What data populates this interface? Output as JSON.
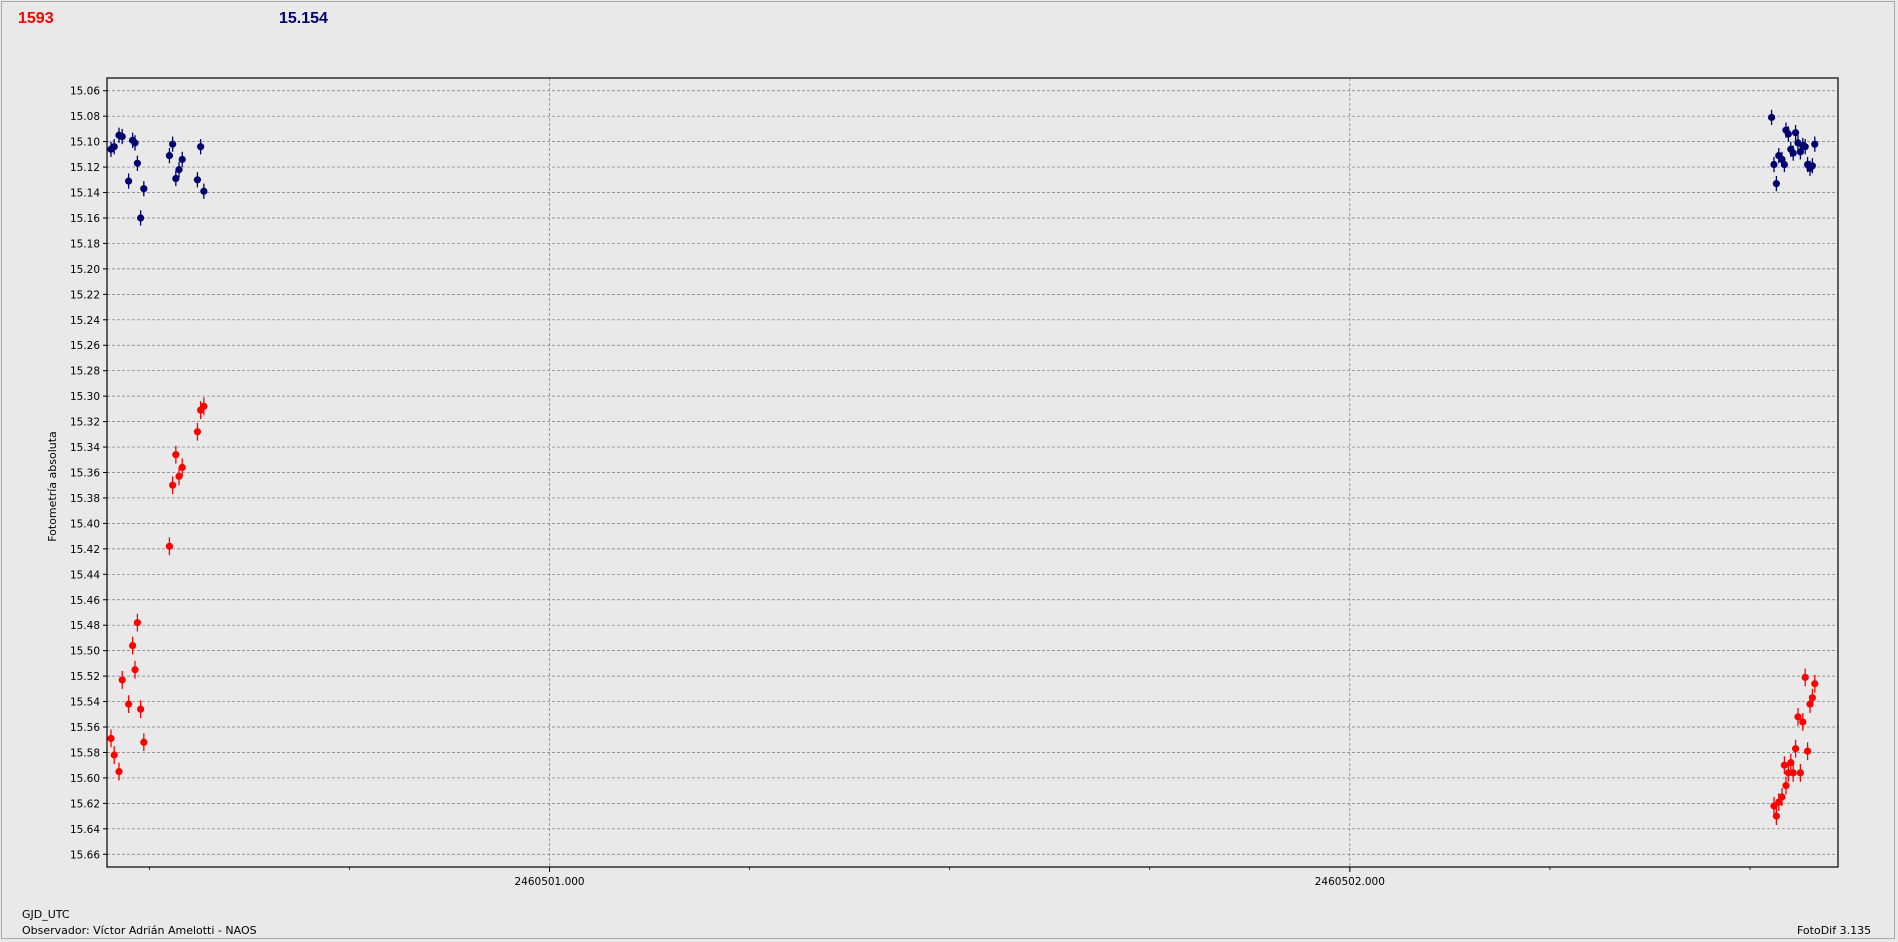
{
  "header": {
    "count": "1593",
    "magnitude": "15.154"
  },
  "footer": {
    "x_axis_name": "GJD_UTC",
    "observer": "Observador: Víctor Adrián Amelotti - NAOS",
    "software": "FotoDif 3.135"
  },
  "colors": {
    "series_red": "#ff0000",
    "series_blue": "#00006e",
    "background": "#e9e9e9"
  },
  "chart_data": {
    "type": "scatter",
    "title": "",
    "xlabel": "GJD_UTC",
    "ylabel": "Fotometría absoluta",
    "y_inverted": true,
    "ylim": [
      15.05,
      15.67
    ],
    "xlim": [
      2460500.447,
      2460502.61
    ],
    "x_ticks": [
      {
        "value": 2460501.0,
        "label": "2460501.000"
      },
      {
        "value": 2460502.0,
        "label": "2460502.000"
      }
    ],
    "y_ticks": [
      "15.06",
      "15.08",
      "15.10",
      "15.12",
      "15.14",
      "15.16",
      "15.18",
      "15.20",
      "15.22",
      "15.24",
      "15.26",
      "15.28",
      "15.30",
      "15.32",
      "15.34",
      "15.36",
      "15.38",
      "15.40",
      "15.42",
      "15.44",
      "15.46",
      "15.48",
      "15.50",
      "15.52",
      "15.54",
      "15.56",
      "15.58",
      "15.60",
      "15.62",
      "15.64",
      "15.66"
    ],
    "grid": true,
    "series": [
      {
        "color": "#ff0000",
        "error": 0.007,
        "points": [
          [
            2460500.452,
            15.569
          ],
          [
            2460500.456,
            15.582
          ],
          [
            2460500.462,
            15.595
          ],
          [
            2460500.466,
            15.523
          ],
          [
            2460500.474,
            15.542
          ],
          [
            2460500.479,
            15.496
          ],
          [
            2460500.482,
            15.515
          ],
          [
            2460500.485,
            15.478
          ],
          [
            2460500.489,
            15.546
          ],
          [
            2460500.493,
            15.572
          ],
          [
            2460500.525,
            15.418
          ],
          [
            2460500.529,
            15.37
          ],
          [
            2460500.533,
            15.346
          ],
          [
            2460500.537,
            15.363
          ],
          [
            2460500.541,
            15.356
          ],
          [
            2460500.56,
            15.328
          ],
          [
            2460500.564,
            15.311
          ],
          [
            2460500.568,
            15.308
          ],
          [
            2460502.53,
            15.622
          ],
          [
            2460502.533,
            15.63
          ],
          [
            2460502.536,
            15.619
          ],
          [
            2460502.54,
            15.615
          ],
          [
            2460502.543,
            15.59
          ],
          [
            2460502.545,
            15.606
          ],
          [
            2460502.548,
            15.596
          ],
          [
            2460502.551,
            15.588
          ],
          [
            2460502.554,
            15.596
          ],
          [
            2460502.557,
            15.577
          ],
          [
            2460502.56,
            15.552
          ],
          [
            2460502.563,
            15.596
          ],
          [
            2460502.566,
            15.556
          ],
          [
            2460502.569,
            15.521
          ],
          [
            2460502.572,
            15.579
          ],
          [
            2460502.575,
            15.542
          ],
          [
            2460502.578,
            15.537
          ],
          [
            2460502.581,
            15.526
          ]
        ]
      },
      {
        "color": "#00006e",
        "error": 0.006,
        "points": [
          [
            2460500.452,
            15.106
          ],
          [
            2460500.456,
            15.104
          ],
          [
            2460500.462,
            15.095
          ],
          [
            2460500.466,
            15.096
          ],
          [
            2460500.474,
            15.131
          ],
          [
            2460500.479,
            15.099
          ],
          [
            2460500.482,
            15.101
          ],
          [
            2460500.485,
            15.117
          ],
          [
            2460500.489,
            15.16
          ],
          [
            2460500.493,
            15.137
          ],
          [
            2460500.525,
            15.111
          ],
          [
            2460500.529,
            15.102
          ],
          [
            2460500.533,
            15.129
          ],
          [
            2460500.537,
            15.122
          ],
          [
            2460500.541,
            15.114
          ],
          [
            2460500.56,
            15.13
          ],
          [
            2460500.564,
            15.104
          ],
          [
            2460500.568,
            15.139
          ],
          [
            2460502.527,
            15.081
          ],
          [
            2460502.53,
            15.118
          ],
          [
            2460502.533,
            15.133
          ],
          [
            2460502.536,
            15.111
          ],
          [
            2460502.54,
            15.114
          ],
          [
            2460502.543,
            15.118
          ],
          [
            2460502.545,
            15.091
          ],
          [
            2460502.548,
            15.094
          ],
          [
            2460502.551,
            15.106
          ],
          [
            2460502.554,
            15.109
          ],
          [
            2460502.557,
            15.093
          ],
          [
            2460502.56,
            15.101
          ],
          [
            2460502.563,
            15.108
          ],
          [
            2460502.566,
            15.103
          ],
          [
            2460502.569,
            15.104
          ],
          [
            2460502.572,
            15.118
          ],
          [
            2460502.575,
            15.121
          ],
          [
            2460502.578,
            15.119
          ],
          [
            2460502.581,
            15.102
          ]
        ]
      }
    ]
  }
}
